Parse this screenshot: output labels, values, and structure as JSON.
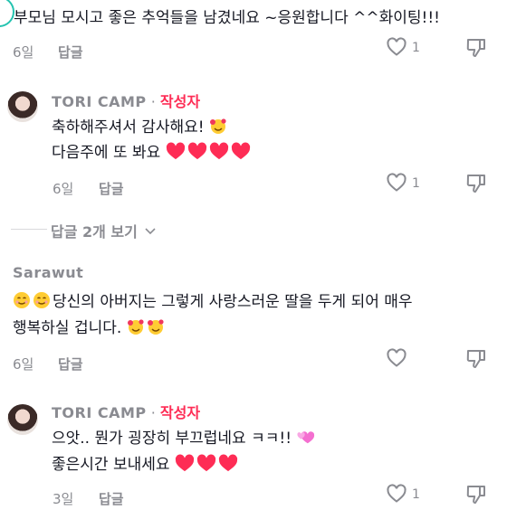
{
  "comments": [
    {
      "text": "부모님 모시고 좋은 추억들을 남겼네요 ~응원합니다 ^^화이팅!!!",
      "time": "6일",
      "reply_label": "답글",
      "like_count": "1"
    },
    {
      "author": "TORI CAMP",
      "separator": "·",
      "badge": "작성자",
      "line1": "축하해주셔서 감사해요!",
      "line2": "다음주에 또 봐요",
      "time": "6일",
      "reply_label": "답글",
      "like_count": "1"
    },
    {
      "view_replies": "답글 2개 보기"
    },
    {
      "author": "Sarawut",
      "line1": "당신의 아버지는 그렇게 사랑스러운 딸을 두게 되어 매우",
      "line2": "행복하실 겁니다.",
      "time": "6일",
      "reply_label": "답글"
    },
    {
      "author": "TORI CAMP",
      "separator": "·",
      "badge": "작성자",
      "line1": "으앗.. 뭔가 굉장히 부끄럽네요 ㅋㅋ!!",
      "line2": "좋은시간 보내세요",
      "time": "3일",
      "reply_label": "답글",
      "like_count": "1"
    }
  ],
  "colors": {
    "creator_badge": "#fe2c55",
    "heart": "#fe2c55",
    "muted": "#8a8b91",
    "avatar_teal": "#25c3b0"
  },
  "icons": [
    "heart-outline-icon",
    "thumbs-down-icon",
    "chevron-down-icon",
    "heart-emoji",
    "smiling-face-with-hearts-emoji",
    "smiling-face-emoji",
    "growing-heart-emoji"
  ]
}
